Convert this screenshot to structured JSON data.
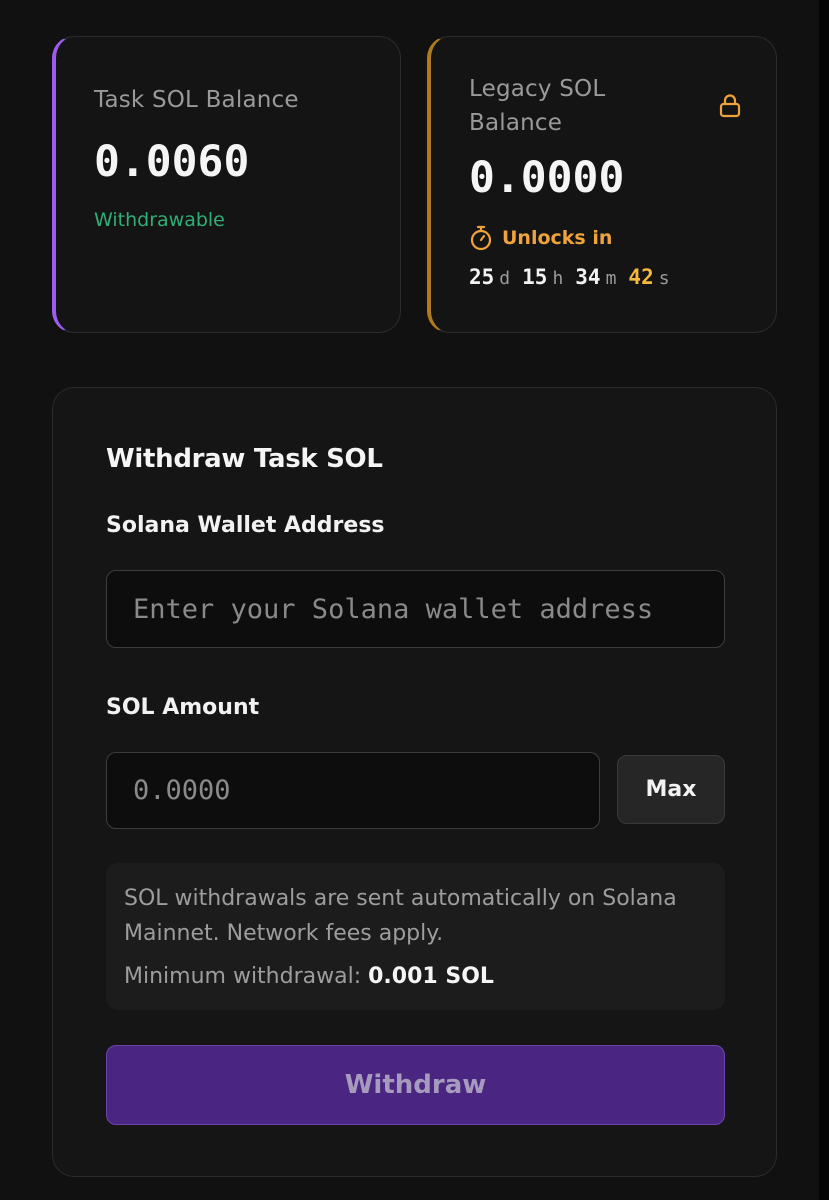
{
  "task_card": {
    "label": "Task SOL Balance",
    "value": "0.0060",
    "status": "Withdrawable"
  },
  "legacy_card": {
    "label": "Legacy SOL Balance",
    "value": "0.0000",
    "locked_icon": "lock-icon",
    "unlocks_label": "Unlocks in",
    "countdown": {
      "days": "25",
      "days_unit": "d",
      "hours": "15",
      "hours_unit": "h",
      "minutes": "34",
      "minutes_unit": "m",
      "seconds": "42",
      "seconds_unit": "s"
    }
  },
  "withdraw_form": {
    "title": "Withdraw Task SOL",
    "address_label": "Solana Wallet Address",
    "address_placeholder": "Enter your Solana wallet address",
    "address_value": "",
    "amount_label": "SOL Amount",
    "amount_placeholder": "0.0000",
    "amount_value": "",
    "max_label": "Max",
    "info_text": "SOL withdrawals are sent automatically on Solana Mainnet. Network fees apply.",
    "min_label": "Minimum withdrawal:",
    "min_value": "0.001 SOL",
    "submit_label": "Withdraw"
  },
  "colors": {
    "background": "#111111",
    "card_background": "#141414",
    "task_accent": "#9b5cf0",
    "legacy_accent": "#b07a20",
    "withdrawable_green": "#2fae76",
    "unlocks_orange": "#f0a33a",
    "seconds_accent": "#f5b83d",
    "button_purple": "#4a2682"
  }
}
